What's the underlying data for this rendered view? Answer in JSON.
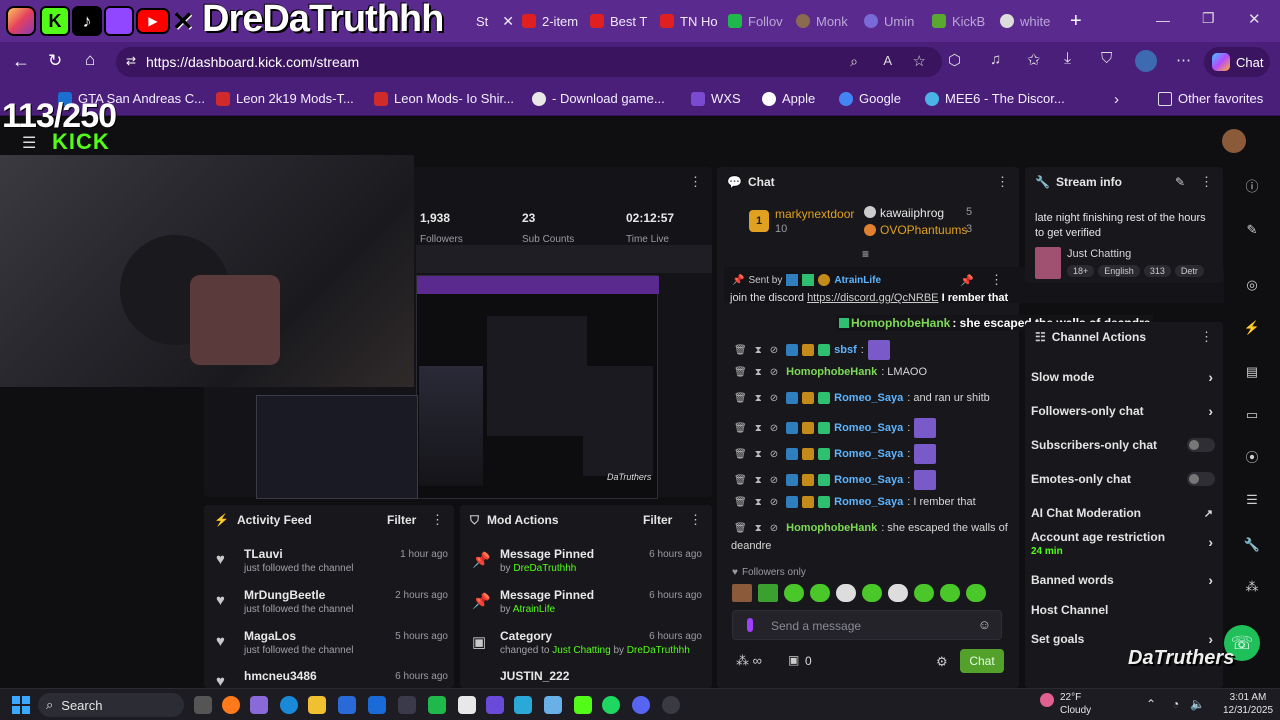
{
  "overlay": {
    "channel_name": "DreDaTruthhh",
    "goal_counter": "113/250",
    "social_icons": [
      "instagram-icon",
      "kick-icon",
      "tiktok-icon",
      "twitch-icon",
      "youtube-icon",
      "x-icon"
    ],
    "watermark": "DaTruthers"
  },
  "browser": {
    "tabs": [
      {
        "label": "St",
        "icon": "kick-icon"
      },
      {
        "label": "2-item",
        "icon": "youtube-icon"
      },
      {
        "label": "Best T",
        "icon": "youtube-icon"
      },
      {
        "label": "TN Ho",
        "icon": "youtube-icon"
      },
      {
        "label": "Follov",
        "icon": "kick-icon"
      },
      {
        "label": "Monk",
        "icon": "monkey-icon"
      },
      {
        "label": "Umin",
        "icon": "chat-icon"
      },
      {
        "label": "KickB",
        "icon": "bot-icon"
      },
      {
        "label": "white",
        "icon": "google-icon"
      }
    ],
    "url": "https://dashboard.kick.com/stream",
    "chat_button": "Chat",
    "favorites": [
      {
        "label": "GTA San Andreas C...",
        "color": "#1a6fd1"
      },
      {
        "label": "Leon 2k19 Mods-T...",
        "color": "#d12a2a"
      },
      {
        "label": "Leon Mods- Io Shir...",
        "color": "#d12a2a"
      },
      {
        "label": "- Download game...",
        "color": "#e8e8e8"
      },
      {
        "label": "WXS",
        "color": "#7a4bd1"
      },
      {
        "label": "Apple",
        "color": "#ffffff"
      },
      {
        "label": "Google",
        "color": "#4285f4"
      },
      {
        "label": "MEE6 - The Discor...",
        "color": "#4ab3e8"
      }
    ],
    "other_favorites": "Other favorites"
  },
  "stats": {
    "followers_value": "1,938",
    "followers_label": "Followers",
    "subs_value": "23",
    "subs_label": "Sub Counts",
    "time_value": "02:12:57",
    "time_label": "Time Live"
  },
  "activity_feed": {
    "title": "Activity Feed",
    "filter": "Filter",
    "items": [
      {
        "name": "TLauvi",
        "desc": "just followed the channel",
        "time": "1 hour ago"
      },
      {
        "name": "MrDungBeetle",
        "desc": "just followed the channel",
        "time": "2 hours ago"
      },
      {
        "name": "MagaLos",
        "desc": "just followed the channel",
        "time": "5 hours ago"
      },
      {
        "name": "hmcneu3486",
        "desc": "",
        "time": "6 hours ago"
      }
    ]
  },
  "mod_actions": {
    "title": "Mod Actions",
    "filter": "Filter",
    "items": [
      {
        "title": "Message Pinned",
        "by": "by",
        "user": "DreDaTruthhh",
        "time": "6 hours ago"
      },
      {
        "title": "Message Pinned",
        "by": "by",
        "user": "AtrainLife",
        "time": "6 hours ago"
      },
      {
        "title": "Category",
        "by": "changed to",
        "user": "Just Chatting",
        "by2": "by",
        "user2": "DreDaTruthhh",
        "time": "6 hours ago"
      },
      {
        "title": "JUSTIN_222",
        "by": "",
        "user": "",
        "time": ""
      }
    ]
  },
  "chat": {
    "title": "Chat",
    "leaderboard": [
      {
        "rank": "1",
        "name": "markynextdoor",
        "count": "10"
      },
      {
        "name": "kawaiiphrog",
        "count": "5"
      },
      {
        "name": "OVOPhantuums",
        "count": "3"
      }
    ],
    "pinned": {
      "sent_by": "Sent by",
      "user": "AtrainLife",
      "message_start": "join the discord",
      "link": "https://discord.gg/QcNRBE",
      "overlap_text": "I rember that"
    },
    "floating_message": {
      "user": "HomophobeHank",
      "text": ": she escaped the walls of deandre"
    },
    "messages": [
      {
        "user": "sbsf",
        "text": ":",
        "style": "blue"
      },
      {
        "user": "HomophobeHank",
        "text": ": LMAOO",
        "style": "green"
      },
      {
        "user": "Romeo_Saya",
        "text": ": and ran ur shitb",
        "style": "blue"
      },
      {
        "user": "Romeo_Saya",
        "text": ":",
        "style": "blue"
      },
      {
        "user": "Romeo_Saya",
        "text": ":",
        "style": "blue"
      },
      {
        "user": "Romeo_Saya",
        "text": ":",
        "style": "blue"
      },
      {
        "user": "Romeo_Saya",
        "text": ": I rember that",
        "style": "blue"
      },
      {
        "user": "HomophobeHank",
        "text": ": she escaped the walls of",
        "style": "green"
      }
    ],
    "wrap_tail": "deandre",
    "followers_only": "Followers only",
    "send_placeholder": "Send a message",
    "send_button": "Chat",
    "viewer_count": "0"
  },
  "stream_info": {
    "title": "Stream info",
    "stream_title": "late night finishing rest of the hours to get verified",
    "category": "Just Chatting",
    "tags": [
      "18+",
      "English",
      "313",
      "Detr"
    ]
  },
  "channel_actions": {
    "title": "Channel Actions",
    "rows": [
      {
        "label": "Slow mode",
        "control": "chevron"
      },
      {
        "label": "Followers-only chat",
        "control": "chevron"
      },
      {
        "label": "Subscribers-only chat",
        "control": "toggle"
      },
      {
        "label": "Emotes-only chat",
        "control": "toggle"
      },
      {
        "label": "AI Chat Moderation",
        "control": "external"
      },
      {
        "label": "Account age restriction",
        "sub": "24 min",
        "control": "chevron"
      },
      {
        "label": "Banned words",
        "control": "chevron"
      },
      {
        "label": "Host Channel",
        "control": "none"
      },
      {
        "label": "Set goals",
        "control": "chevron"
      }
    ]
  },
  "taskbar": {
    "search": "Search",
    "weather_temp": "22°F",
    "weather_desc": "Cloudy",
    "time": "3:01 AM",
    "date": "12/31/2025"
  },
  "colors": {
    "kick_green": "#53fc18",
    "browser_purple": "#5b2a8e",
    "panel": "#18181c"
  }
}
